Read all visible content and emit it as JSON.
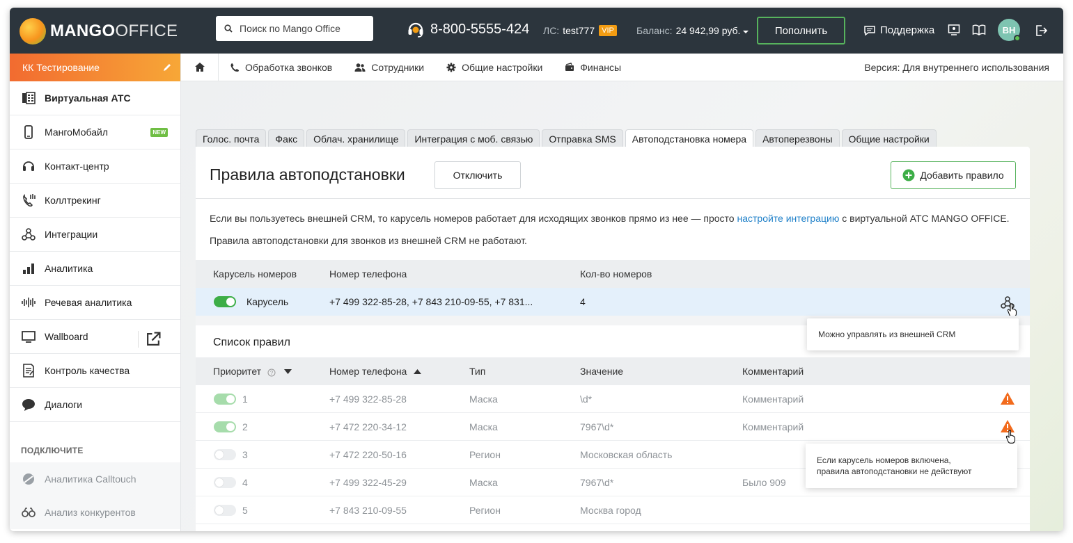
{
  "header": {
    "logo_bold": "MANGO",
    "logo_light": "OFFICE",
    "search_placeholder": "Поиск по Mango Office",
    "phone": "8-800-5555-424",
    "ls_label": "ЛС:",
    "ls_value": "test777",
    "vip": "VIP",
    "balance_label": "Баланс:",
    "balance_value": "24 942,99 руб.",
    "topup": "Пополнить",
    "support": "Поддержка",
    "avatar": "ВН",
    "accent": "#57b35d"
  },
  "sidebar": {
    "company": "КК Тестирование",
    "items": [
      {
        "label": "Виртуальная АТС"
      },
      {
        "label": "МангоМобайл",
        "badge": "NEW"
      },
      {
        "label": "Контакт-центр"
      },
      {
        "label": "Коллтрекинг"
      },
      {
        "label": "Интеграции"
      },
      {
        "label": "Аналитика"
      },
      {
        "label": "Речевая аналитика"
      },
      {
        "label": "Wallboard"
      },
      {
        "label": "Контроль качества"
      },
      {
        "label": "Диалоги"
      }
    ],
    "connect_title": "ПОДКЛЮЧИТЕ",
    "connect_items": [
      {
        "label": "Аналитика Calltouch"
      },
      {
        "label": "Анализ конкурентов"
      }
    ]
  },
  "nav": {
    "items": [
      "Обработка звонков",
      "Сотрудники",
      "Общие настройки",
      "Финансы"
    ],
    "version": "Версия: Для внутреннего использования"
  },
  "tabs": [
    "Голос. почта",
    "Факс",
    "Облач. хранилище",
    "Интеграция с моб. связью",
    "Отправка SMS",
    "Автоподстановка номера",
    "Автоперезвоны",
    "Общие настройки"
  ],
  "main": {
    "title": "Правила автоподстановки",
    "disable": "Отключить",
    "add_rule": "Добавить правило",
    "info1_pre": "Если вы пользуетесь внешней CRM, то карусель номеров работает для исходящих звонков прямо из нее — просто ",
    "info1_link": "настройте интеграцию",
    "info1_post": " с виртуальной АТС MANGO OFFICE.",
    "info2": "Правила автоподстановки для звонков из внешней CRM не работают.",
    "carousel_headers": [
      "Карусель номеров",
      "Номер телефона",
      "Кол-во номеров"
    ],
    "carousel_row": {
      "name": "Карусель",
      "phones": "+7 499 322-85-28, +7 843 210-09-55, +7 831...",
      "count": "4"
    },
    "tip1": "Можно управлять из внешней CRM",
    "list_title": "Список правил",
    "rule_headers": [
      "Приоритет",
      "Номер телефона",
      "Тип",
      "Значение",
      "Комментарий"
    ],
    "rules": [
      {
        "priority": "1",
        "phone": "+7 499 322-85-28",
        "type": "Маска",
        "value": "\\d*",
        "comment": "Комментарий"
      },
      {
        "priority": "2",
        "phone": "+7 472 220-34-12",
        "type": "Маска",
        "value": "7967\\d*",
        "comment": "Комментарий"
      },
      {
        "priority": "3",
        "phone": "+7 472 220-50-16",
        "type": "Регион",
        "value": "Московская область",
        "comment": ""
      },
      {
        "priority": "4",
        "phone": "+7 499 322-45-29",
        "type": "Маска",
        "value": "7967\\d*",
        "comment": "Было 909"
      },
      {
        "priority": "5",
        "phone": "+7 843 210-09-55",
        "type": "Регион",
        "value": "Москва город",
        "comment": ""
      }
    ],
    "tip2_line1": "Если карусель номеров включена,",
    "tip2_line2": "правила автоподстановки не действуют"
  }
}
